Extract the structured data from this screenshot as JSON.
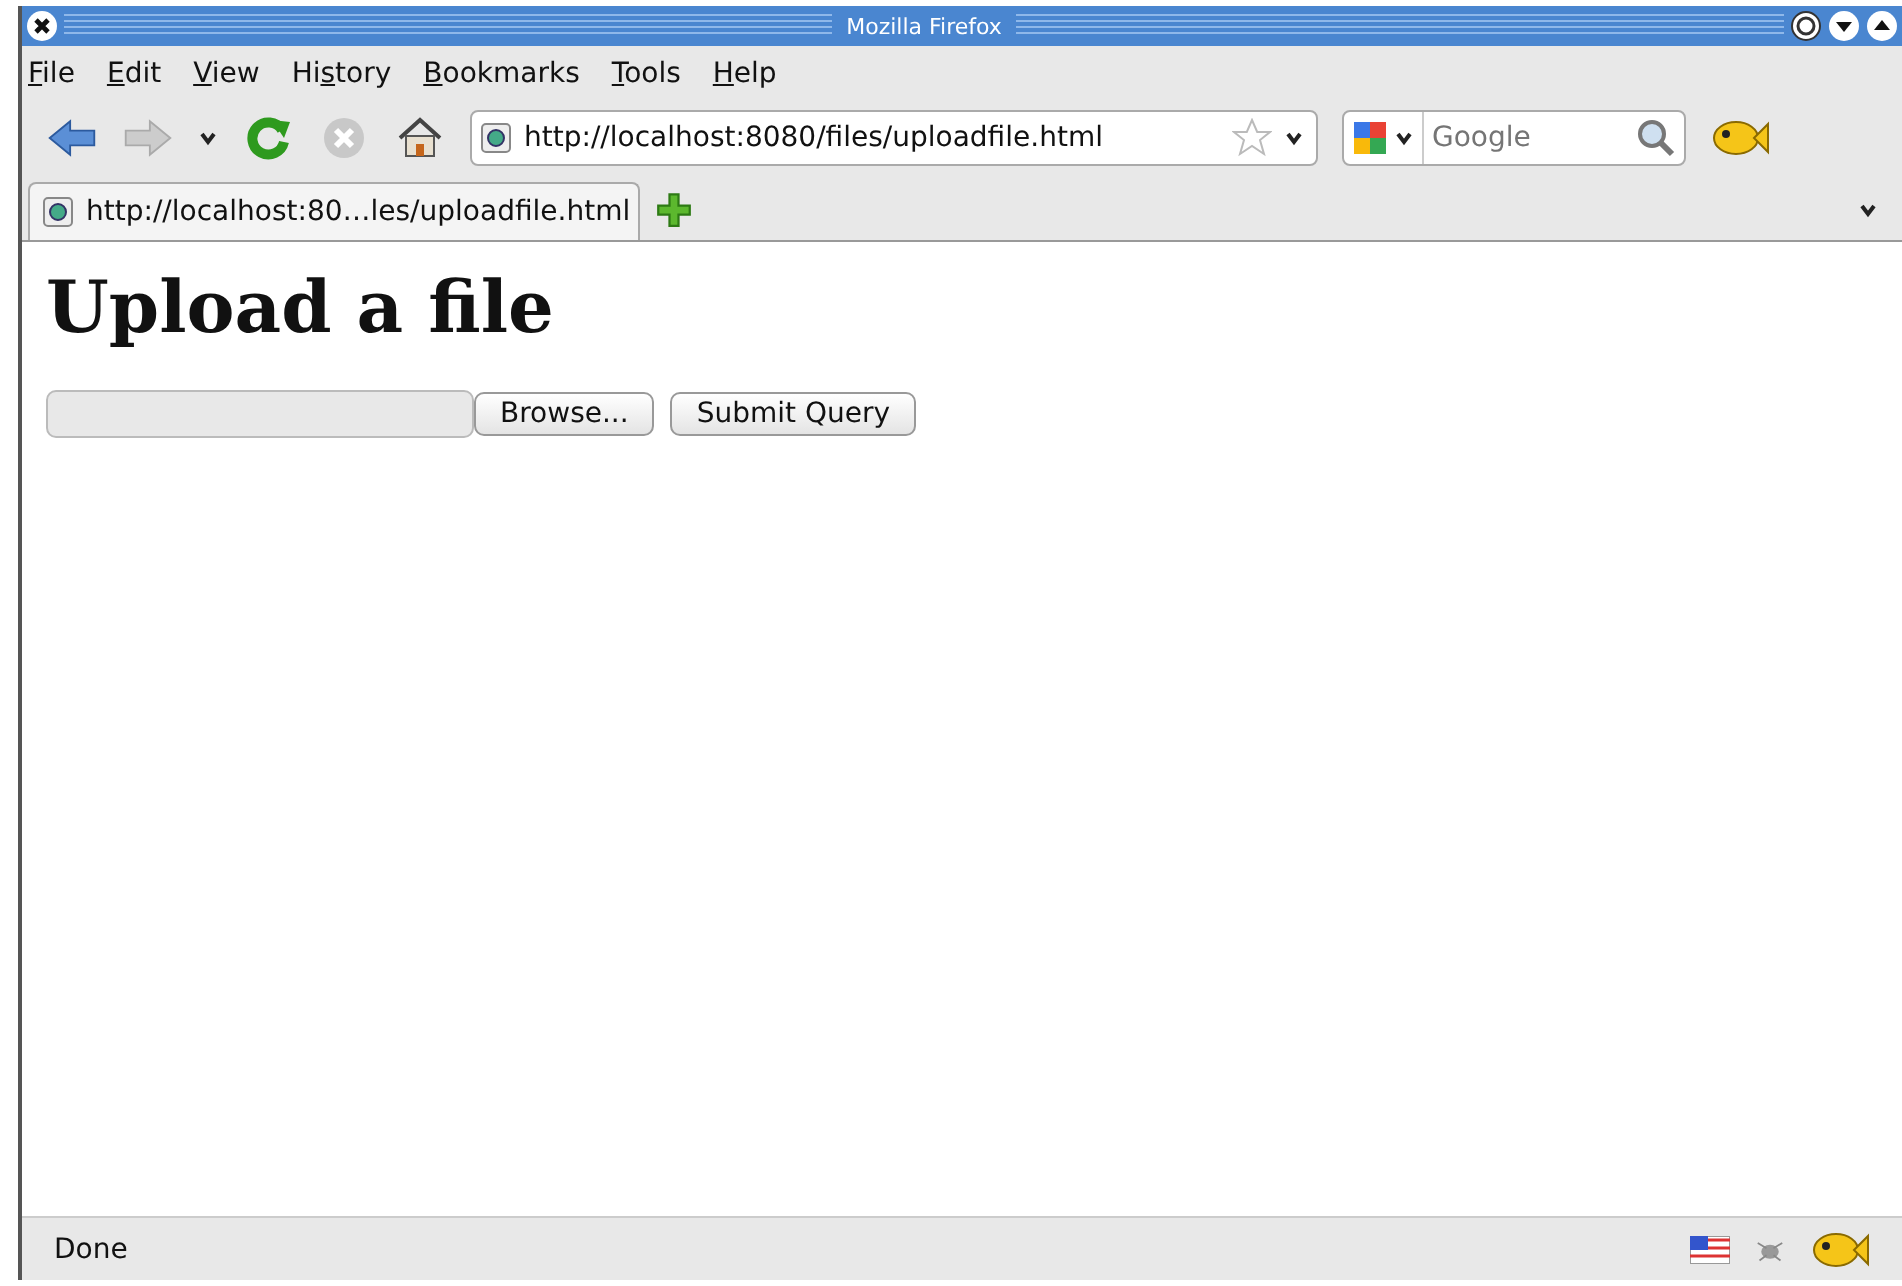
{
  "window": {
    "title": "Mozilla Firefox"
  },
  "menu": [
    {
      "key": "F",
      "post": "ile"
    },
    {
      "key": "E",
      "post": "dit"
    },
    {
      "key": "V",
      "post": "iew"
    },
    {
      "pre": "Hi",
      "key": "s",
      "post": "tory"
    },
    {
      "key": "B",
      "post": "ookmarks"
    },
    {
      "key": "T",
      "post": "ools"
    },
    {
      "key": "H",
      "post": "elp"
    }
  ],
  "toolbar": {
    "url": "http://localhost:8080/files/uploadfile.html",
    "search": {
      "placeholder": "Google"
    }
  },
  "tabs": [
    {
      "label": "http://localhost:80…les/uploadfile.html",
      "selected": true
    }
  ],
  "page": {
    "heading": "Upload a file",
    "browse_button": "Browse...",
    "submit_button": "Submit Query"
  },
  "status_bar": {
    "text": "Done"
  }
}
